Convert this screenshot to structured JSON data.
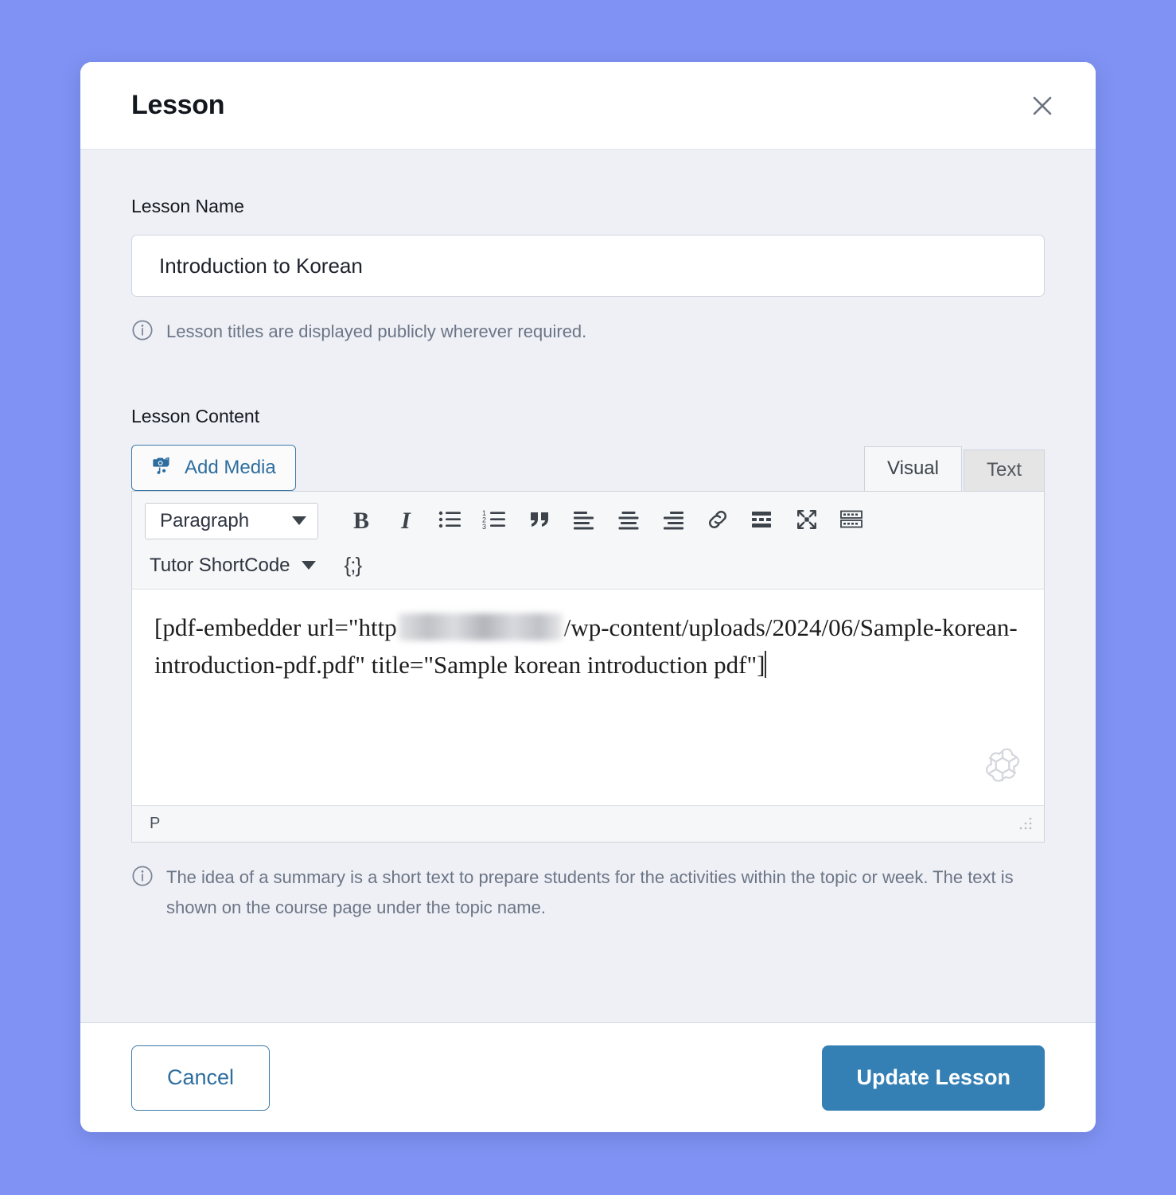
{
  "theme": {
    "page_background": "#8093f4",
    "modal_background": "#ffffff",
    "body_background": "#eef0f6",
    "accent_blue": "#3480b4",
    "link_blue": "#2e6e9e",
    "muted_text": "#6c7585"
  },
  "modal": {
    "title": "Lesson",
    "close_icon": "close-icon"
  },
  "lesson_name": {
    "label": "Lesson Name",
    "value": "Introduction to Korean",
    "placeholder": "Lesson Name",
    "hint": "Lesson titles are displayed publicly wherever required.",
    "hint_icon": "info-circle-icon"
  },
  "lesson_content": {
    "label": "Lesson Content",
    "add_media_label": "Add Media",
    "add_media_icon": "media-camera-music-icon",
    "tabs": [
      {
        "label": "Visual",
        "active": true
      },
      {
        "label": "Text",
        "active": false
      }
    ],
    "toolbar_row1": {
      "format_select": "Paragraph",
      "format_caret_icon": "chevron-down-icon",
      "buttons": [
        {
          "name": "bold-button",
          "glyph": "B",
          "title": "Bold"
        },
        {
          "name": "italic-button",
          "glyph": "I",
          "title": "Italic"
        },
        {
          "name": "bulleted-list-button",
          "icon": "bulleted-list-icon"
        },
        {
          "name": "numbered-list-button",
          "icon": "numbered-list-icon"
        },
        {
          "name": "blockquote-button",
          "icon": "quote-icon"
        },
        {
          "name": "align-left-button",
          "icon": "align-left-icon"
        },
        {
          "name": "align-center-button",
          "icon": "align-center-icon"
        },
        {
          "name": "align-right-button",
          "icon": "align-right-icon"
        },
        {
          "name": "insert-link-button",
          "icon": "link-icon"
        },
        {
          "name": "read-more-button",
          "icon": "read-more-icon"
        },
        {
          "name": "fullscreen-button",
          "icon": "fullscreen-expand-icon"
        },
        {
          "name": "toolbar-toggle-button",
          "icon": "keyboard-toolbar-icon"
        }
      ]
    },
    "toolbar_row2": {
      "shortcode_label": "Tutor ShortCode",
      "shortcode_caret_icon": "chevron-down-icon",
      "code_snippet_glyph": "{;}"
    },
    "editor_text_segments": [
      {
        "type": "text",
        "value": "[pdf-embedder url=\"http"
      },
      {
        "type": "redacted",
        "value": ""
      },
      {
        "type": "text",
        "value": "/wp-content/uploads/2024/06/Sample-korean-introduction-pdf.pdf\" title=\"Sample korean introduction pdf\"]"
      }
    ],
    "editor_text_plain": "[pdf-embedder url=\"http://••••••••••/wp-content/uploads/2024/06/Sample-korean-introduction-pdf.pdf\" title=\"Sample korean introduction pdf\"]",
    "watermark_icon": "openai-logo-icon",
    "status_path": "P",
    "resize_handle_icon": "resize-grip-icon",
    "hint": "The idea of a summary is a short text to prepare students for the activities within the topic or week. The text is shown on the course page under the topic name.",
    "hint_icon": "info-circle-icon"
  },
  "footer": {
    "cancel_label": "Cancel",
    "update_label": "Update Lesson"
  }
}
